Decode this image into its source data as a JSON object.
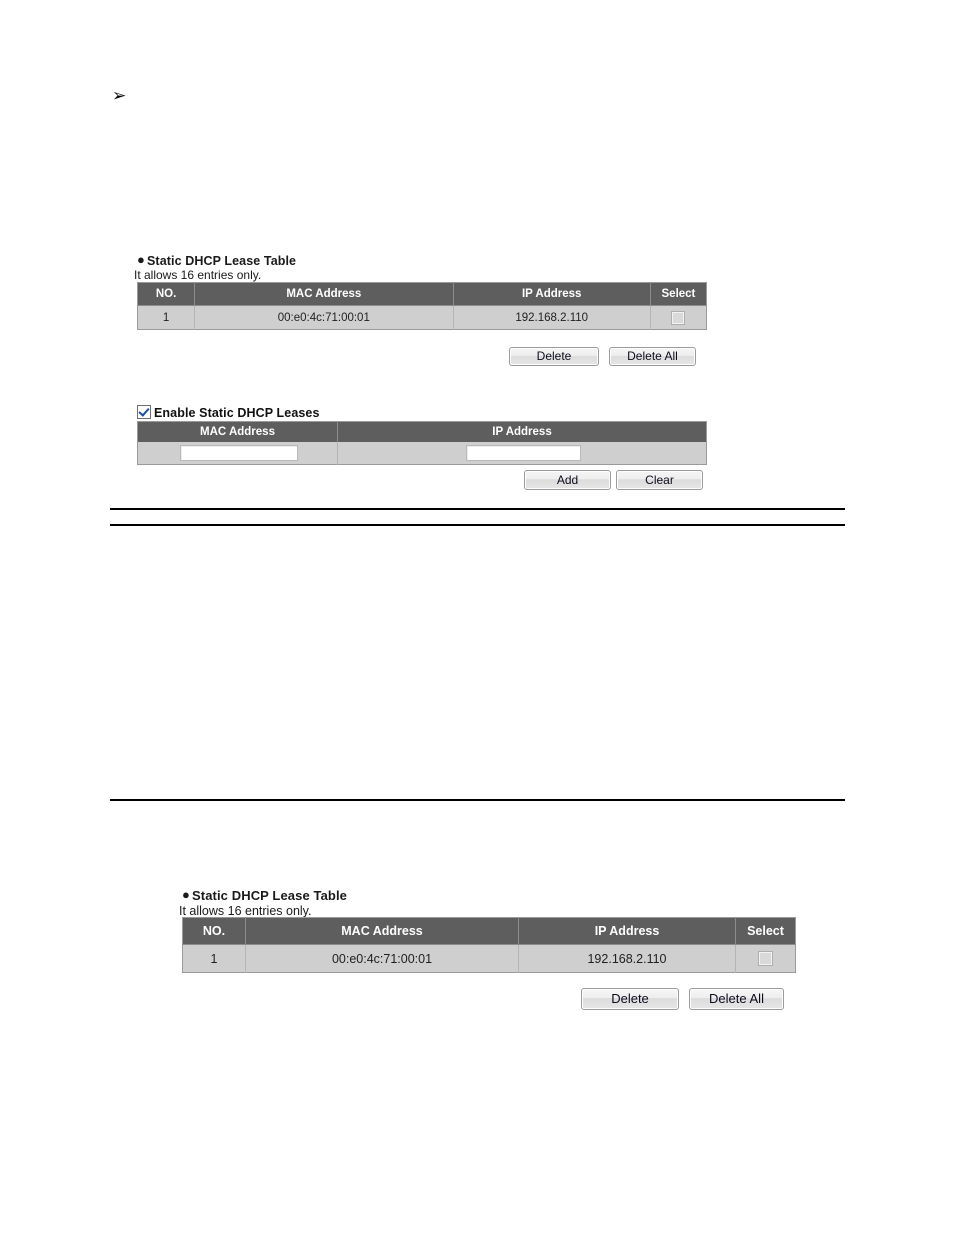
{
  "page": {
    "arrow_bullet_glyph": "➢"
  },
  "top_section": {
    "bullet": "●",
    "heading": "Static DHCP Lease Table",
    "subtext": "It allows 16 entries only.",
    "table": {
      "columns": [
        "NO.",
        "MAC Address",
        "IP Address",
        "Select"
      ],
      "rows": [
        {
          "no": "1",
          "mac": "00:e0:4c:71:00:01",
          "ip": "192.168.2.110",
          "selected": false
        }
      ]
    },
    "buttons": {
      "delete": "Delete",
      "delete_all": "Delete All"
    }
  },
  "form_section": {
    "enable_label": "Enable Static DHCP Leases",
    "enable_checked": true,
    "columns": [
      "MAC Address",
      "IP Address"
    ],
    "mac_value": "",
    "ip_value": "",
    "mac_placeholder": "",
    "ip_placeholder": "",
    "buttons": {
      "add": "Add",
      "clear": "Clear"
    }
  },
  "bottom_section": {
    "bullet": "●",
    "heading": "Static DHCP Lease Table",
    "subtext": "It allows 16 entries only.",
    "table": {
      "columns": [
        "NO.",
        "MAC Address",
        "IP Address",
        "Select"
      ],
      "rows": [
        {
          "no": "1",
          "mac": "00:e0:4c:71:00:01",
          "ip": "192.168.2.110",
          "selected": false
        }
      ]
    },
    "buttons": {
      "delete": "Delete",
      "delete_all": "Delete All"
    }
  },
  "colors": {
    "header_bg": "#5e5e5e",
    "row_bg": "#cfcfcf",
    "header_text": "#ffffff",
    "checkbox_accent": "#1b4fa0",
    "rule": "#000000"
  }
}
